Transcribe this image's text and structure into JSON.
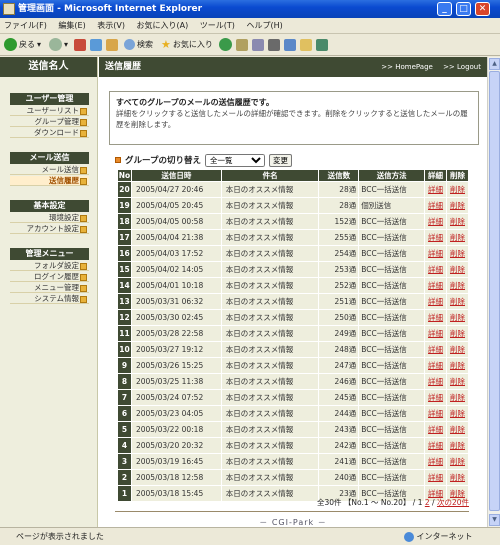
{
  "window": {
    "title": "管理画面 - Microsoft Internet Explorer"
  },
  "menubar": [
    "ファイル(F)",
    "編集(E)",
    "表示(V)",
    "お気に入り(A)",
    "ツール(T)",
    "ヘルプ(H)"
  ],
  "toolbar": {
    "back": "戻る",
    "search": "検索",
    "favorites": "お気に入り"
  },
  "sidebar": {
    "site_title": "送信名人",
    "sections": [
      {
        "title": "ユーザー管理",
        "items": [
          {
            "label": "ユーザーリスト",
            "active": false
          },
          {
            "label": "グループ管理",
            "active": false
          },
          {
            "label": "ダウンロード",
            "active": false
          }
        ]
      },
      {
        "title": "メール送信",
        "items": [
          {
            "label": "メール送信",
            "active": false
          },
          {
            "label": "送信履歴",
            "active": true
          }
        ]
      },
      {
        "title": "基本設定",
        "items": [
          {
            "label": "環境設定",
            "active": false
          },
          {
            "label": "アカウント設定",
            "active": false
          }
        ]
      },
      {
        "title": "管理メニュー",
        "items": [
          {
            "label": "フォルダ設定",
            "active": false
          },
          {
            "label": "ログイン履歴",
            "active": false
          },
          {
            "label": "メニュー管理",
            "active": false
          },
          {
            "label": "システム情報",
            "active": false
          }
        ]
      }
    ]
  },
  "main": {
    "heading": "送信履歴",
    "homepage": ">> HomePage",
    "logout": ">> Logout",
    "notice_title": "すべてのグループのメールの送信履歴です。",
    "notice_line1": "詳細をクリックすると送信したメールの詳細が確認できます。削除をクリックすると送信したメールの履",
    "notice_line2": "歴を削除します。",
    "group_label": "グループの切り替え",
    "group_selected": "全一覧",
    "change_button": "変更"
  },
  "table": {
    "headers": [
      "No",
      "送信日時",
      "件名",
      "送信数",
      "送信方法",
      "詳細",
      "削除"
    ],
    "detail_label": "詳細",
    "delete_label": "削除",
    "rows": [
      {
        "no": "20",
        "date": "2005/04/27 20:46",
        "subject": "本日のオススメ情報",
        "count": "28通",
        "method": "BCC一括送信"
      },
      {
        "no": "19",
        "date": "2005/04/05 20:45",
        "subject": "本日のオススメ情報",
        "count": "28通",
        "method": "個別送信"
      },
      {
        "no": "18",
        "date": "2005/04/05 00:58",
        "subject": "本日のオススメ情報",
        "count": "152通",
        "method": "BCC一括送信"
      },
      {
        "no": "17",
        "date": "2005/04/04 21:38",
        "subject": "本日のオススメ情報",
        "count": "255通",
        "method": "BCC一括送信"
      },
      {
        "no": "16",
        "date": "2005/04/03 17:52",
        "subject": "本日のオススメ情報",
        "count": "254通",
        "method": "BCC一括送信"
      },
      {
        "no": "15",
        "date": "2005/04/02 14:05",
        "subject": "本日のオススメ情報",
        "count": "253通",
        "method": "BCC一括送信"
      },
      {
        "no": "14",
        "date": "2005/04/01 10:18",
        "subject": "本日のオススメ情報",
        "count": "252通",
        "method": "BCC一括送信"
      },
      {
        "no": "13",
        "date": "2005/03/31 06:32",
        "subject": "本日のオススメ情報",
        "count": "251通",
        "method": "BCC一括送信"
      },
      {
        "no": "12",
        "date": "2005/03/30 02:45",
        "subject": "本日のオススメ情報",
        "count": "250通",
        "method": "BCC一括送信"
      },
      {
        "no": "11",
        "date": "2005/03/28 22:58",
        "subject": "本日のオススメ情報",
        "count": "249通",
        "method": "BCC一括送信"
      },
      {
        "no": "10",
        "date": "2005/03/27 19:12",
        "subject": "本日のオススメ情報",
        "count": "248通",
        "method": "BCC一括送信"
      },
      {
        "no": "9",
        "date": "2005/03/26 15:25",
        "subject": "本日のオススメ情報",
        "count": "247通",
        "method": "BCC一括送信"
      },
      {
        "no": "8",
        "date": "2005/03/25 11:38",
        "subject": "本日のオススメ情報",
        "count": "246通",
        "method": "BCC一括送信"
      },
      {
        "no": "7",
        "date": "2005/03/24 07:52",
        "subject": "本日のオススメ情報",
        "count": "245通",
        "method": "BCC一括送信"
      },
      {
        "no": "6",
        "date": "2005/03/23 04:05",
        "subject": "本日のオススメ情報",
        "count": "244通",
        "method": "BCC一括送信"
      },
      {
        "no": "5",
        "date": "2005/03/22 00:18",
        "subject": "本日のオススメ情報",
        "count": "243通",
        "method": "BCC一括送信"
      },
      {
        "no": "4",
        "date": "2005/03/20 20:32",
        "subject": "本日のオススメ情報",
        "count": "242通",
        "method": "BCC一括送信"
      },
      {
        "no": "3",
        "date": "2005/03/19 16:45",
        "subject": "本日のオススメ情報",
        "count": "241通",
        "method": "BCC一括送信"
      },
      {
        "no": "2",
        "date": "2005/03/18 12:58",
        "subject": "本日のオススメ情報",
        "count": "240通",
        "method": "BCC一括送信"
      },
      {
        "no": "1",
        "date": "2005/03/18 15:45",
        "subject": "本日のオススメ情報",
        "count": "23通",
        "method": "BCC一括送信"
      }
    ]
  },
  "pagination": {
    "summary": "全30件 【No.1 〜 No.20】 /",
    "current": "1",
    "page2": "2",
    "sep": "/",
    "next": "次の20件"
  },
  "footer": "－ CGI-Park －",
  "status": {
    "left": "ページが表示されました",
    "right": "インターネット"
  }
}
